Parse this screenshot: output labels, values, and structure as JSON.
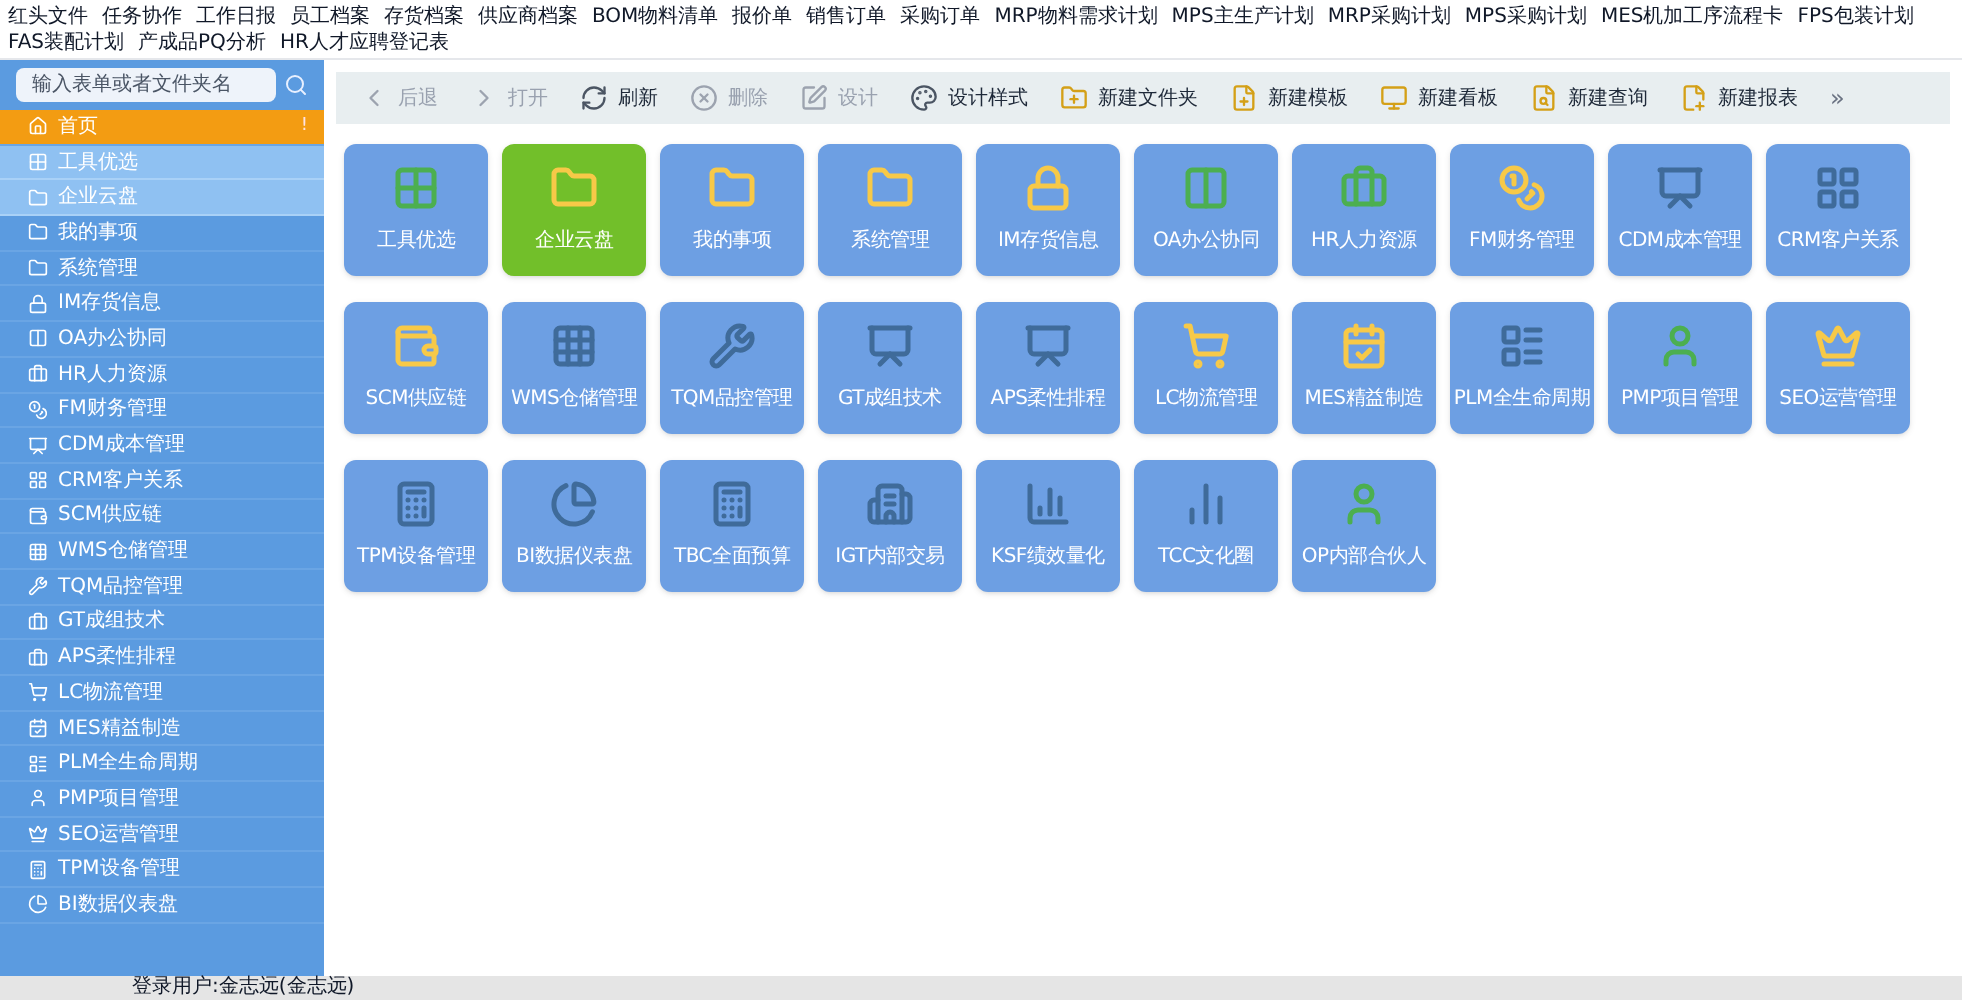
{
  "top_menu": [
    "红头文件",
    "任务协作",
    "工作日报",
    "员工档案",
    "存货档案",
    "供应商档案",
    "BOM物料清单",
    "报价单",
    "销售订单",
    "采购订单",
    "MRP物料需求计划",
    "MPS主生产计划",
    "MRP采购计划",
    "MPS采购计划",
    "MES机加工序流程卡",
    "FPS包装计划",
    "FAS装配计划",
    "产成品PQ分析",
    "HR人才应聘登记表"
  ],
  "sidebar": {
    "search": {
      "placeholder": "输入表单或者文件夹名"
    },
    "items": [
      {
        "label": "首页",
        "selected": true,
        "highlighted": false,
        "badge": "!"
      },
      {
        "label": "工具优选",
        "selected": false,
        "highlighted": true
      },
      {
        "label": "企业云盘",
        "selected": false,
        "highlighted": true
      },
      {
        "label": "我的事项",
        "selected": false,
        "highlighted": false
      },
      {
        "label": "系统管理",
        "selected": false,
        "highlighted": false
      },
      {
        "label": "IM存货信息",
        "selected": false,
        "highlighted": false
      },
      {
        "label": "OA办公协同",
        "selected": false,
        "highlighted": false
      },
      {
        "label": "HR人力资源",
        "selected": false,
        "highlighted": false
      },
      {
        "label": "FM财务管理",
        "selected": false,
        "highlighted": false
      },
      {
        "label": "CDM成本管理",
        "selected": false,
        "highlighted": false
      },
      {
        "label": "CRM客户关系",
        "selected": false,
        "highlighted": false
      },
      {
        "label": "SCM供应链",
        "selected": false,
        "highlighted": false
      },
      {
        "label": "WMS仓储管理",
        "selected": false,
        "highlighted": false
      },
      {
        "label": "TQM品控管理",
        "selected": false,
        "highlighted": false
      },
      {
        "label": "GT成组技术",
        "selected": false,
        "highlighted": false
      },
      {
        "label": "APS柔性排程",
        "selected": false,
        "highlighted": false
      },
      {
        "label": "LC物流管理",
        "selected": false,
        "highlighted": false
      },
      {
        "label": "MES精益制造",
        "selected": false,
        "highlighted": false
      },
      {
        "label": "PLM全生命周期",
        "selected": false,
        "highlighted": false
      },
      {
        "label": "PMP项目管理",
        "selected": false,
        "highlighted": false
      },
      {
        "label": "SEO运营管理",
        "selected": false,
        "highlighted": false
      },
      {
        "label": "TPM设备管理",
        "selected": false,
        "highlighted": false
      },
      {
        "label": "BI数据仪表盘",
        "selected": false,
        "highlighted": false
      }
    ]
  },
  "toolbar": [
    {
      "label": "后退",
      "disabled": true
    },
    {
      "label": "打开",
      "disabled": true
    },
    {
      "label": "刷新",
      "disabled": false
    },
    {
      "label": "删除",
      "disabled": true
    },
    {
      "label": "设计",
      "disabled": true
    },
    {
      "label": "设计样式",
      "disabled": false
    },
    {
      "label": "新建文件夹",
      "disabled": false
    },
    {
      "label": "新建模板",
      "disabled": false
    },
    {
      "label": "新建看板",
      "disabled": false
    },
    {
      "label": "新建查询",
      "disabled": false
    },
    {
      "label": "新建报表",
      "disabled": false
    }
  ],
  "toolbar_more": "»",
  "tiles": [
    {
      "label": "工具优选",
      "selected": false
    },
    {
      "label": "企业云盘",
      "selected": true
    },
    {
      "label": "我的事项",
      "selected": false
    },
    {
      "label": "系统管理",
      "selected": false
    },
    {
      "label": "IM存货信息",
      "selected": false
    },
    {
      "label": "OA办公协同",
      "selected": false
    },
    {
      "label": "HR人力资源",
      "selected": false
    },
    {
      "label": "FM财务管理",
      "selected": false
    },
    {
      "label": "CDM成本管理",
      "selected": false
    },
    {
      "label": "CRM客户关系",
      "selected": false
    },
    {
      "label": "SCM供应链",
      "selected": false
    },
    {
      "label": "WMS仓储管理",
      "selected": false
    },
    {
      "label": "TQM品控管理",
      "selected": false
    },
    {
      "label": "GT成组技术",
      "selected": false
    },
    {
      "label": "APS柔性排程",
      "selected": false
    },
    {
      "label": "LC物流管理",
      "selected": false
    },
    {
      "label": "MES精益制造",
      "selected": false
    },
    {
      "label": "PLM全生命周期",
      "selected": false
    },
    {
      "label": "PMP项目管理",
      "selected": false
    },
    {
      "label": "SEO运营管理",
      "selected": false
    },
    {
      "label": "TPM设备管理",
      "selected": false
    },
    {
      "label": "BI数据仪表盘",
      "selected": false
    },
    {
      "label": "TBC全面预算",
      "selected": false
    },
    {
      "label": "IGT内部交易",
      "selected": false
    },
    {
      "label": "KSF绩效量化",
      "selected": false
    },
    {
      "label": "TCC文化圈",
      "selected": false
    },
    {
      "label": "OP内部合伙人",
      "selected": false
    }
  ],
  "status_bar": "登录用户:金志远(金志远)"
}
